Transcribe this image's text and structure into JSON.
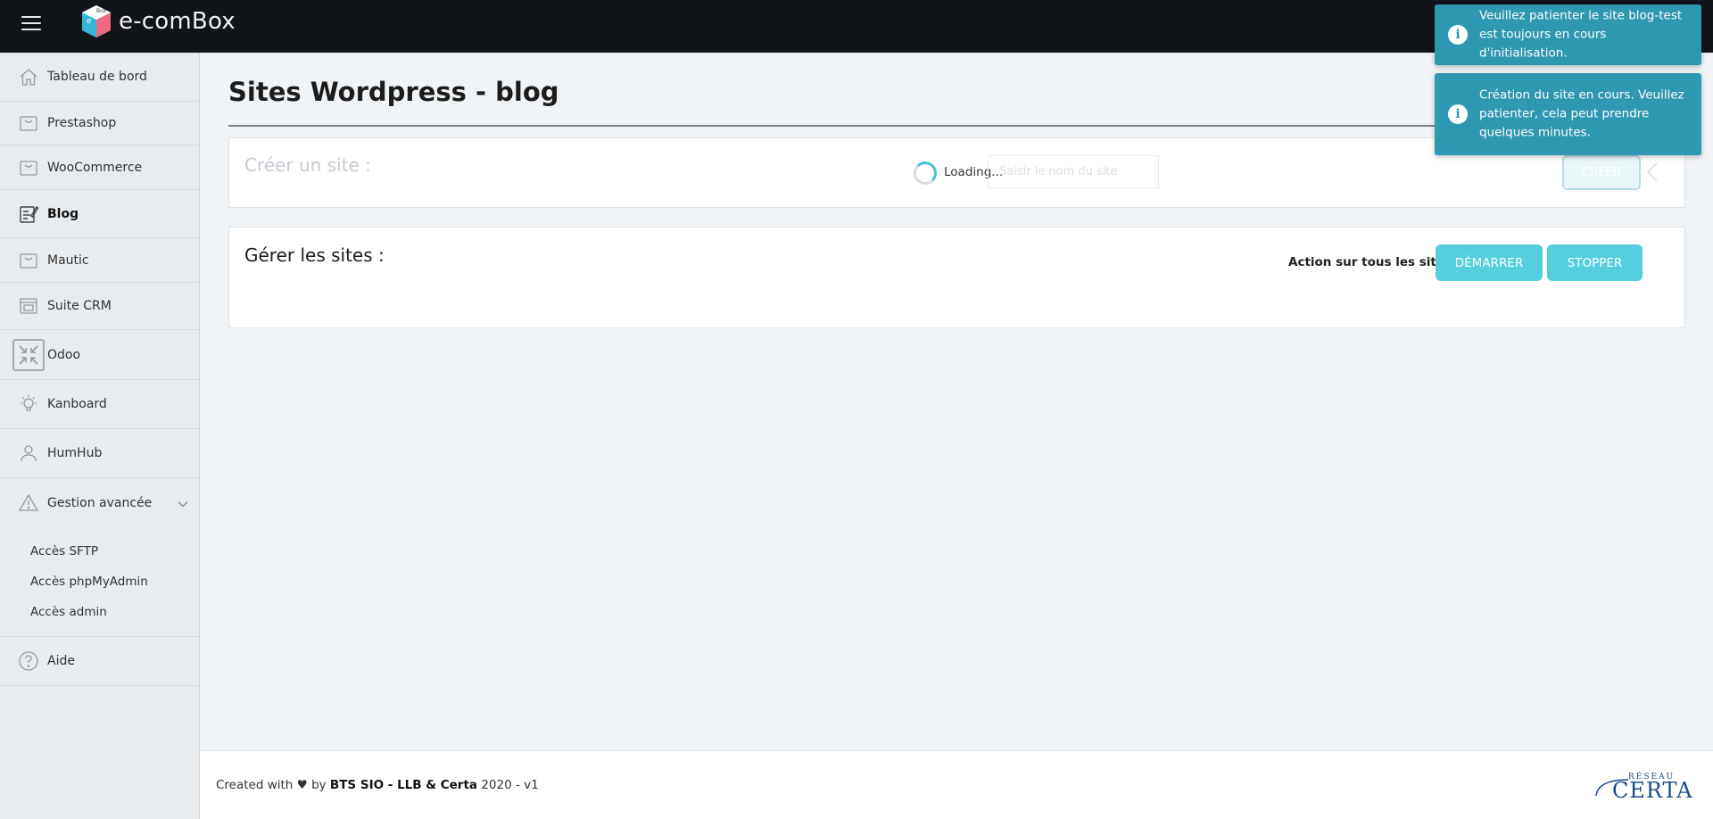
{
  "header": {
    "brand": "e-comBox",
    "logo_letters": "Box"
  },
  "sidebar": {
    "items": [
      {
        "label": "Tableau de bord",
        "icon": "home-icon"
      },
      {
        "label": "Prestashop",
        "icon": "basket-icon"
      },
      {
        "label": "WooCommerce",
        "icon": "basket-icon"
      },
      {
        "label": "Blog",
        "icon": "edit-note-icon",
        "active": true
      },
      {
        "label": "Mautic",
        "icon": "basket-icon"
      },
      {
        "label": "Suite CRM",
        "icon": "browser-window-icon"
      },
      {
        "label": "Odoo",
        "icon": "compress-arrows-icon"
      },
      {
        "label": "Kanboard",
        "icon": "lightbulb-icon"
      },
      {
        "label": "HumHub",
        "icon": "user-icon"
      },
      {
        "label": "Gestion avancée",
        "icon": "warning-icon",
        "expanded": true
      }
    ],
    "subitems": [
      {
        "label": "Accès SFTP"
      },
      {
        "label": "Accès phpMyAdmin"
      },
      {
        "label": "Accès admin"
      }
    ],
    "help": {
      "label": "Aide",
      "icon": "help-icon"
    }
  },
  "main": {
    "title": "Sites Wordpress - blog",
    "create": {
      "title": "Créer un site :",
      "loading": "Loading...",
      "input_placeholder": "Saisir le nom du site",
      "button": "CRÉER"
    },
    "manage": {
      "title": "Gérer les sites :",
      "action_label": "Action sur tous les sites :",
      "start_button": "DÉMARRER",
      "stop_button": "STOPPER"
    }
  },
  "footer": {
    "prefix": "Created with",
    "heart": "♥",
    "by": "by",
    "org": "BTS SIO - LLB & Certa",
    "suffix": "2020 - v1",
    "logo_top": "RÉSEAU",
    "logo_main": "CERTA"
  },
  "toasts": [
    {
      "text": "Veuillez patienter le site blog-test est toujours en cours d'initialisation.",
      "icon": "info-icon"
    },
    {
      "text": "Création du site en cours. Veuillez patienter, cela peut prendre quelques minutes.",
      "icon": "info-icon"
    }
  ],
  "colors": {
    "topbar": "#111418",
    "toast": "#2e98b3",
    "button": "#55cfe0",
    "sidebar": "#e9ecef"
  }
}
